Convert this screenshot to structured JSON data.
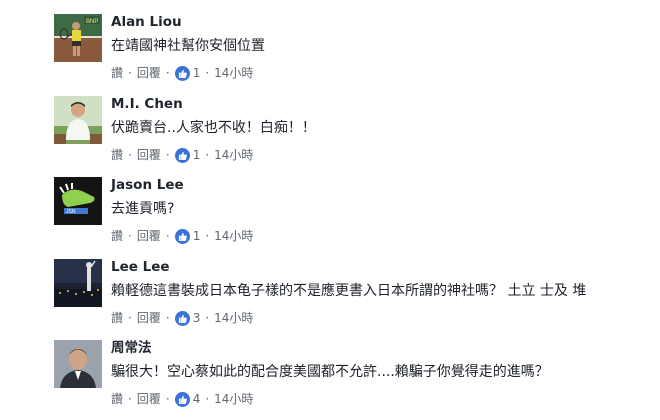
{
  "colors": {
    "like_blue": "#3b72d9",
    "meta_gray": "#606770",
    "name_dark": "#20262f"
  },
  "comments": [
    {
      "name": "Alan Liou",
      "text": "在靖國神社幫你安個位置",
      "like": "讚",
      "reply": "回覆",
      "count": "1",
      "time": "14小時",
      "avatar_icon": "tennis-photo"
    },
    {
      "name": "M.I. Chen",
      "text": "伏跪賣台..人家也不收！白痴！！",
      "like": "讚",
      "reply": "回覆",
      "count": "1",
      "time": "14小時",
      "avatar_icon": "person-photo"
    },
    {
      "name": "Jason Lee",
      "text": "去進貢嗎?",
      "like": "讚",
      "reply": "回覆",
      "count": "1",
      "time": "14小時",
      "avatar_icon": "shoe-logo"
    },
    {
      "name": "Lee Lee",
      "text": "賴軽德這書裝成日本龟子樣的不是應更書入日本所謂的神社嗎？ 土立 士及 堆",
      "like": "讚",
      "reply": "回覆",
      "count": "3",
      "time": "14小時",
      "avatar_icon": "night-city-photo"
    },
    {
      "name": "周常法",
      "text": "騙很大！空心蔡如此的配合度美國都不允許....賴騙子你覺得走的進嗎？",
      "like": "讚",
      "reply": "回覆",
      "count": "4",
      "time": "14小時",
      "avatar_icon": "portrait-photo"
    }
  ]
}
